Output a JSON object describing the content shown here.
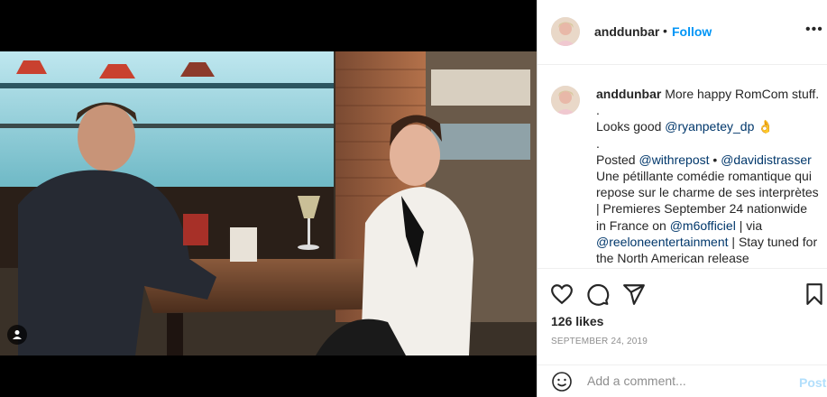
{
  "post": {
    "username": "anddunbar",
    "follow_dot": "•",
    "follow_label": "Follow",
    "more_label": "•••"
  },
  "caption": {
    "username": "anddunbar",
    "line1": " More happy RomCom stuff. .\nLooks good ",
    "mention1": "@ryanpetey_dp",
    "emoji": " 👌",
    "line2": "\n.\nPosted ",
    "mention2": "@withrepost",
    "sep": " • ",
    "mention3": "@davidistrasser",
    "line3": "\nUne pétillante comédie romantique qui repose sur le charme de ses interprètes | Premieres September 24 nationwide in France on ",
    "mention4": "@m6officiel",
    "line4": " | via ",
    "mention5": "@reeloneentertainment",
    "line5": " | Stay tuned for the North American release"
  },
  "stats": {
    "likes": "126 likes",
    "date": "SEPTEMBER 24, 2019"
  },
  "comment_box": {
    "placeholder": "Add a comment...",
    "post_label": "Post"
  },
  "colors": {
    "accent": "#0095f6",
    "post_disabled": "#b2dffc",
    "text": "#262626",
    "muted": "#8e8e8e"
  },
  "icons": [
    "heart-icon",
    "comment-icon",
    "share-icon",
    "bookmark-icon",
    "smile-icon",
    "more-icon",
    "user-tag-icon"
  ]
}
